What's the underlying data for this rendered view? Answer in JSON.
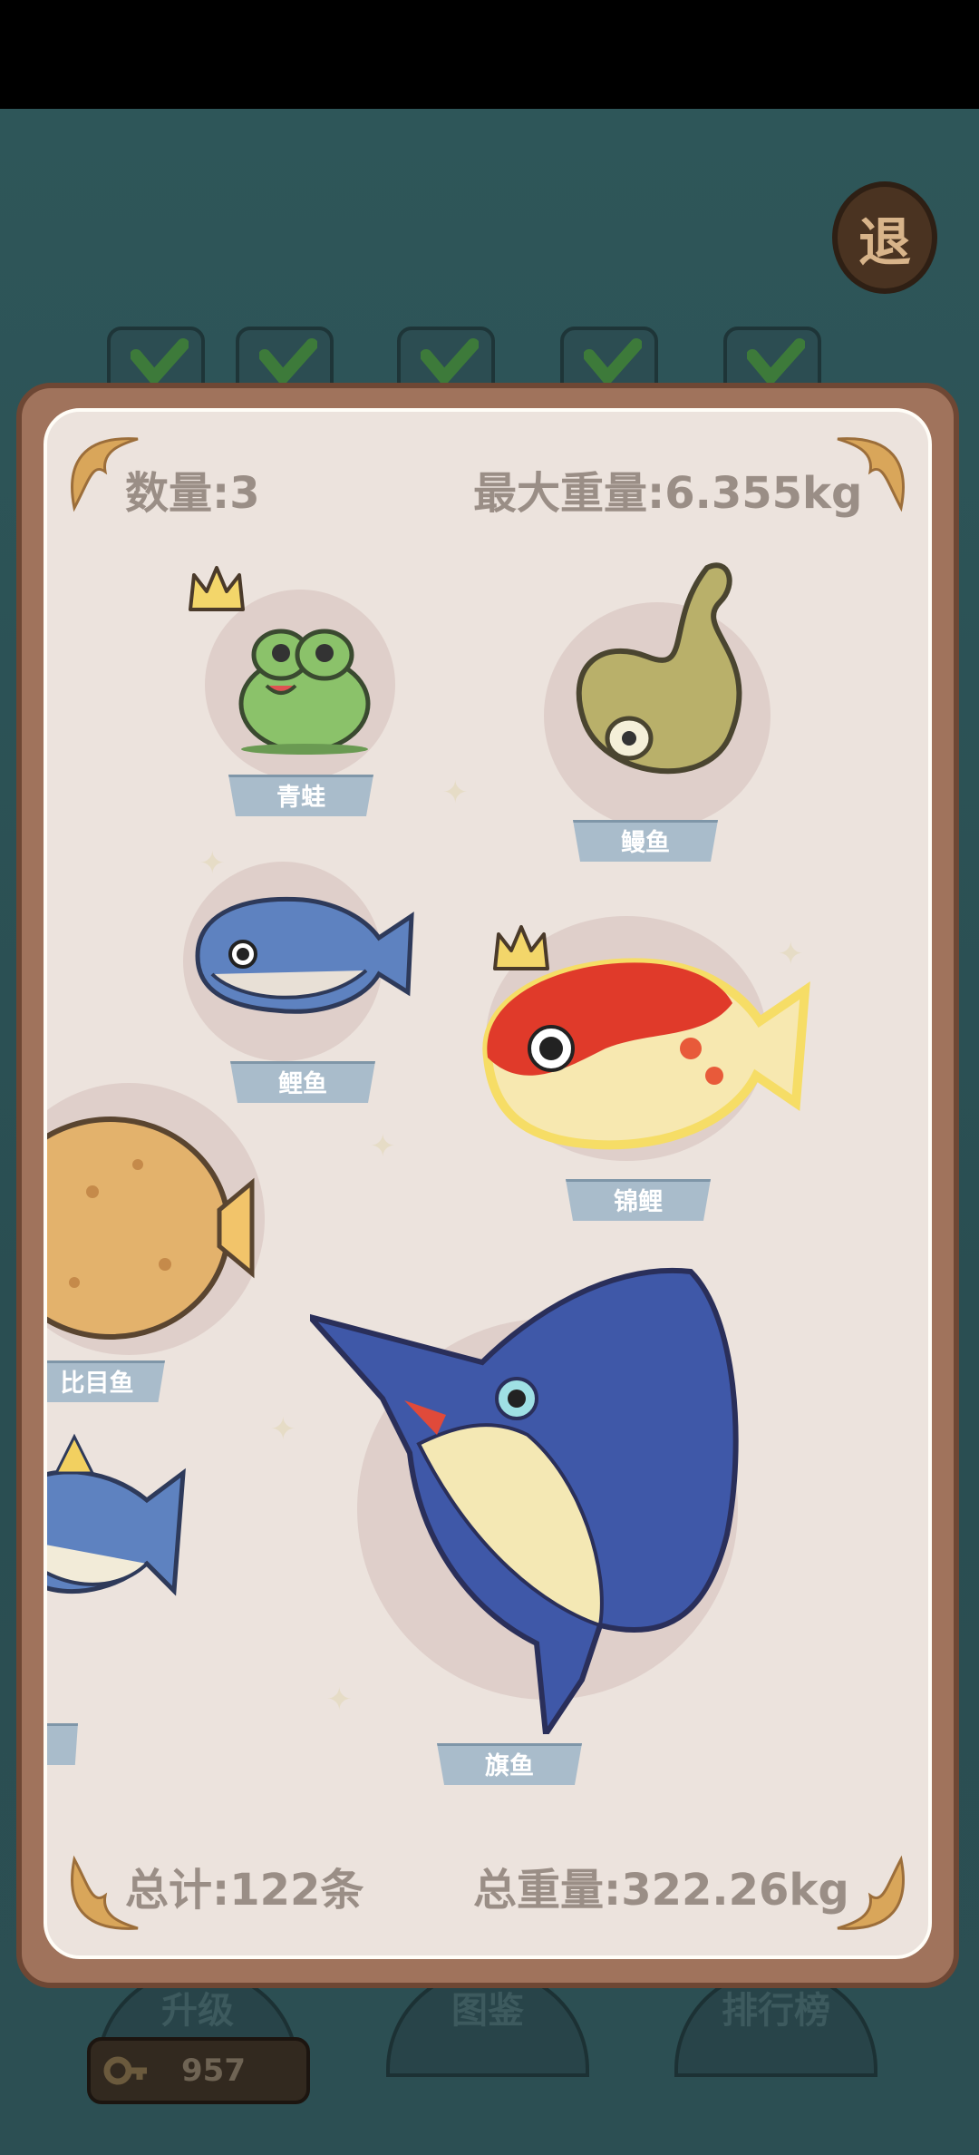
{
  "exit_button": {
    "label": "退"
  },
  "stats": {
    "count": "数量:3",
    "max_weight": "最大重量:6.355kg",
    "total": "总计:122条",
    "total_weight": "总重量:322.26kg"
  },
  "fish": [
    {
      "name": "青蛙",
      "crowned": true
    },
    {
      "name": "鳗鱼",
      "crowned": false
    },
    {
      "name": "鲤鱼",
      "crowned": false
    },
    {
      "name": "锦鲤",
      "crowned": true
    },
    {
      "name": "比目鱼",
      "crowned": false
    },
    {
      "name": "旗鱼",
      "crowned": false
    }
  ],
  "bottom_buttons": {
    "upgrade": "升级",
    "catalog": "图鉴",
    "ranking": "排行榜"
  },
  "coins": {
    "value": "957"
  },
  "colors": {
    "panel_frame": "#a0735c",
    "panel_bg": "#ece3dd",
    "label_bg": "#a9bccb",
    "stat_text": "#9a8e86"
  }
}
